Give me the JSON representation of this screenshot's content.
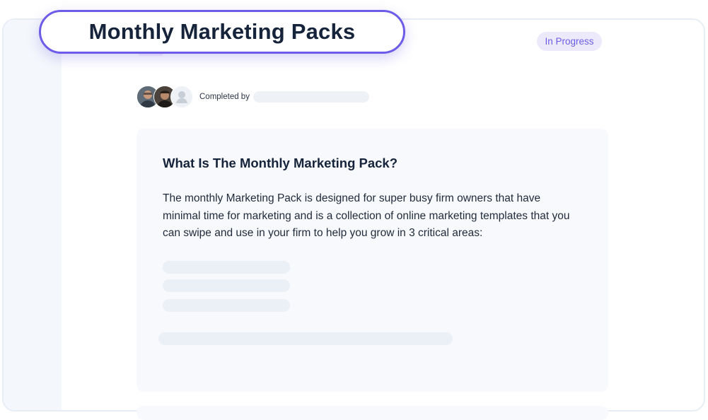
{
  "title": "Monthly Marketing Packs",
  "status": "In Progress",
  "completion": {
    "label": "Completed by",
    "avatars": [
      "user-avatar-1",
      "user-avatar-2",
      "placeholder-avatar"
    ]
  },
  "section": {
    "heading": "What Is The Monthly Marketing Pack?",
    "body": "The monthly Marketing Pack is designed for super busy firm owners that have minimal time for marketing and is a collection of online marketing templates that you can swipe and use in your firm to help you grow in 3 critical areas:"
  },
  "colors": {
    "accent": "#6c5ce7",
    "badge_bg": "#ece9fb",
    "heading": "#15233b"
  }
}
